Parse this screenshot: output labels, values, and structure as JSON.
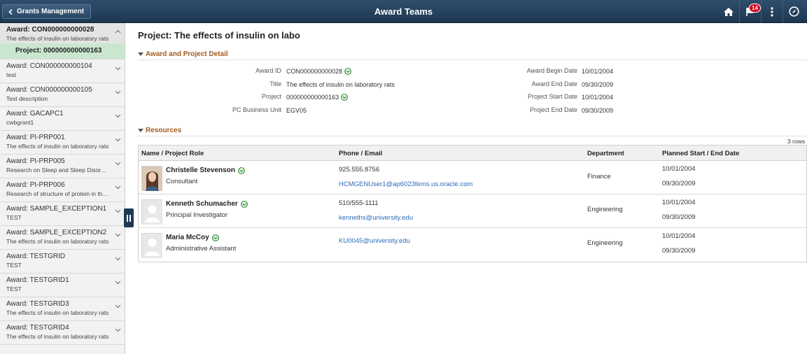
{
  "header": {
    "back_label": "Grants Management",
    "title": "Award Teams",
    "notification_count": "14"
  },
  "sidebar": {
    "items": [
      {
        "title": "Award: CON000000000028",
        "subtitle": "The effects of insulin on laboratory rats",
        "child": "Project: 000000000000163",
        "active": true
      },
      {
        "title": "Award: CON000000000104",
        "subtitle": "test"
      },
      {
        "title": "Award: CON000000000105",
        "subtitle": "Test description"
      },
      {
        "title": "Award: GACAPC1",
        "subtitle": "cwbgrant1"
      },
      {
        "title": "Award: PI-PRP001",
        "subtitle": "The effects of insulin on laboratory rats"
      },
      {
        "title": "Award: PI-PRP005",
        "subtitle": "Research on Sleep and Sleep Disorders"
      },
      {
        "title": "Award: PI-PRP006",
        "subtitle": "Research of structure of protein in the..."
      },
      {
        "title": "Award: SAMPLE_EXCEPTION1",
        "subtitle": "TEST"
      },
      {
        "title": "Award: SAMPLE_EXCEPTION2",
        "subtitle": "The effects of insulin on laboratory rats"
      },
      {
        "title": "Award: TESTGRID",
        "subtitle": "TEST"
      },
      {
        "title": "Award: TESTGRID1",
        "subtitle": "TEST"
      },
      {
        "title": "Award: TESTGRID3",
        "subtitle": "The effects of insulin on laboratory rats"
      },
      {
        "title": "Award: TESTGRID4",
        "subtitle": "The effects of insulin on laboratory rats"
      }
    ]
  },
  "main": {
    "page_title": "Project: The effects of insulin on labo",
    "detail_section": "Award and Project Detail",
    "fields_left": [
      {
        "label": "Award ID",
        "value": "CON000000000028",
        "related": true
      },
      {
        "label": "Title",
        "value": "The effects of insulin on laboratory rats",
        "related": false
      },
      {
        "label": "Project",
        "value": "000000000000163",
        "related": true
      },
      {
        "label": "PC Business Unit",
        "value": "EGV05",
        "related": false
      }
    ],
    "fields_right": [
      {
        "label": "Award Begin Date",
        "value": "10/01/2004"
      },
      {
        "label": "Award End Date",
        "value": "09/30/2009"
      },
      {
        "label": "Project Start Date",
        "value": "10/01/2004"
      },
      {
        "label": "Project End Date",
        "value": "09/30/2009"
      }
    ],
    "resources_section": "Resources",
    "rows_count": "3 rows",
    "columns": [
      "Name / Project Role",
      "Phone / Email",
      "Department",
      "Planned Start / End Date"
    ],
    "rows": [
      {
        "name": "Christelle Stevenson",
        "role": "Consultant",
        "phone": "925.555.8756",
        "email": "HCMGENUser1@ap6023fems.us.oracle.com",
        "department": "Finance",
        "start": "10/01/2004",
        "end": "09/30/2009",
        "has_photo": true
      },
      {
        "name": "Kenneth Schumacher",
        "role": "Principal Investigator",
        "phone": "510/555-1111",
        "email": "kenneths@university.edu",
        "department": "Engineering",
        "start": "10/01/2004",
        "end": "09/30/2009",
        "has_photo": false
      },
      {
        "name": "Maria McCoy",
        "role": "Administrative Assistant",
        "phone": "",
        "email": "KU0045@university.edu",
        "department": "Engineering",
        "start": "10/01/2004",
        "end": "09/30/2009",
        "has_photo": false
      }
    ]
  },
  "colors": {
    "header_bg": "#1d3751",
    "section_text": "#a35b1e",
    "active_child_bg": "#c9e7cf",
    "link": "#2d6bb8",
    "related_icon": "#2a8a2e"
  },
  "icons": {
    "back": "chevron-left-icon",
    "home": "home-icon",
    "notifications": "flag-icon",
    "actions": "vertical-dots-icon",
    "navbar": "compass-icon",
    "related": "related-content-icon",
    "expand": "chevron-down-icon",
    "collapse_panel": "pause-bars-icon"
  }
}
